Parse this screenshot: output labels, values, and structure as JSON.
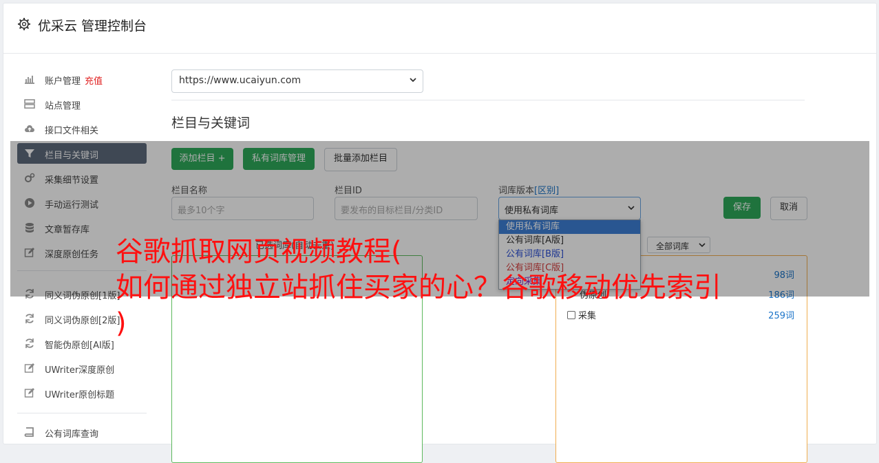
{
  "header": {
    "title": "优采云 管理控制台"
  },
  "sidebar": {
    "items": [
      {
        "label": "账户管理",
        "badge": "充值",
        "icon": "bar-chart-icon"
      },
      {
        "label": "站点管理",
        "icon": "server-icon"
      },
      {
        "label": "接口文件相关",
        "icon": "cloud-upload-icon"
      },
      {
        "label": "栏目与关键词",
        "icon": "filter-icon",
        "active": true
      },
      {
        "label": "采集细节设置",
        "icon": "gears-icon"
      },
      {
        "label": "手动运行测试",
        "icon": "play-circle-icon"
      },
      {
        "label": "文章暂存库",
        "icon": "database-icon"
      },
      {
        "label": "深度原创任务",
        "icon": "edit-icon"
      },
      {
        "label": "同义词伪原创[1版]",
        "icon": "refresh-icon"
      },
      {
        "label": "同义词伪原创[2版]",
        "icon": "refresh-icon"
      },
      {
        "label": "智能伪原创[AI版]",
        "icon": "refresh-icon"
      },
      {
        "label": "UWriter深度原创",
        "icon": "edit-icon"
      },
      {
        "label": "UWriter原创标题",
        "icon": "edit-icon"
      },
      {
        "label": "公有词库查询",
        "icon": "book-icon"
      }
    ]
  },
  "main": {
    "site_select": "https://www.ucaiyun.com",
    "section_title": "栏目与关键词",
    "buttons": {
      "add_column": "添加栏目 +",
      "private_lib": "私有词库管理",
      "batch_add": "批量添加栏目",
      "save": "保存",
      "cancel": "取消"
    },
    "form": {
      "name_label": "栏目名称",
      "name_placeholder": "最多10个字",
      "id_label": "栏目ID",
      "id_placeholder": "要发布的目标栏目/分类ID",
      "version_label": "词库版本",
      "version_link": "[区别]",
      "version_selected": "使用私有词库"
    },
    "dropdown_options": [
      "使用私有词库",
      "公有词库[A版]",
      "公有词库[B版]",
      "公有词库[C版]",
      "定向采集"
    ],
    "selected_words_label": "已选词库(自动去重)",
    "lib_filter": "全部词库",
    "lib_rows": [
      {
        "name": "",
        "count": "98词"
      },
      {
        "name": "伪原创",
        "count": "186词"
      },
      {
        "name": "采集",
        "count": "259词"
      }
    ]
  },
  "watermark": {
    "line1": "谷歌抓取网页视频教程(",
    "line2": "如何通过独立站抓住买家的心？谷歌移动优先索引",
    "line3": ")"
  }
}
